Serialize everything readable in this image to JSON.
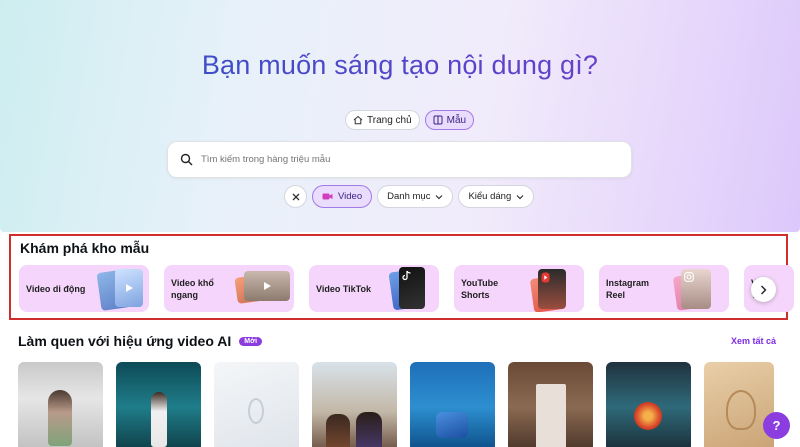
{
  "hero": {
    "title": "Bạn muốn sáng tạo nội dung gì?"
  },
  "tabs": [
    {
      "label": "Trang chủ",
      "icon": "home-icon",
      "active": false
    },
    {
      "label": "Mẫu",
      "icon": "template-icon",
      "active": true
    }
  ],
  "search": {
    "placeholder": "Tìm kiếm trong hàng triệu mẫu",
    "value": ""
  },
  "filters": {
    "clear_icon": "close-icon",
    "video_label": "Video",
    "category_label": "Danh mục",
    "style_label": "Kiểu dáng"
  },
  "explore": {
    "title": "Khám phá kho mẫu",
    "cards": [
      {
        "label": "Video di động"
      },
      {
        "label": "Video khổ ngang"
      },
      {
        "label": "Video TikTok"
      },
      {
        "label": "YouTube Shorts"
      },
      {
        "label": "Instagram Reel"
      }
    ],
    "partial_card_label": "V Y"
  },
  "ai_section": {
    "title": "Làm quen với hiệu ứng video AI",
    "badge": "Mới",
    "see_all": "Xem tất cả"
  },
  "help": {
    "label": "?"
  },
  "colors": {
    "accent": "#8b3ddf",
    "card_bg": "#f5d5fb",
    "highlight_border": "#d02d2d"
  }
}
